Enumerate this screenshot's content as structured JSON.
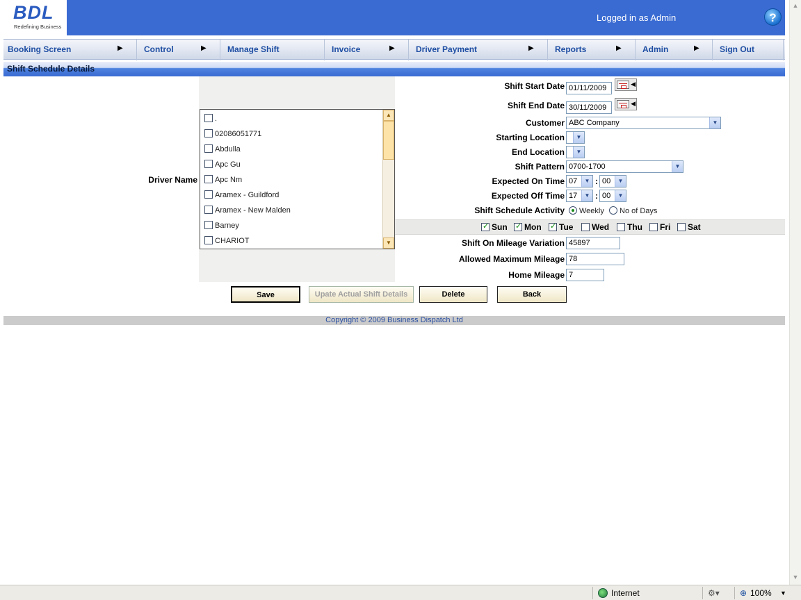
{
  "header": {
    "logo": "BDL",
    "tagline": "Redefining Business",
    "logged_in": "Logged in as Admin",
    "help": "?"
  },
  "menu": [
    {
      "label": "Booking Screen"
    },
    {
      "label": "Control"
    },
    {
      "label": "Manage Shift"
    },
    {
      "label": "Invoice"
    },
    {
      "label": "Driver Payment"
    },
    {
      "label": "Reports"
    },
    {
      "label": "Admin"
    },
    {
      "label": "Sign Out"
    }
  ],
  "page_title": "Shift Schedule Details",
  "driver": {
    "label": "Driver Name",
    "items": [
      ".",
      "02086051771",
      "Abdulla",
      "Apc Gu",
      "Apc Nm",
      "Aramex - Guildford",
      "Aramex - New Malden",
      "Barney",
      "CHARIOT"
    ]
  },
  "form": {
    "start_date_label": "Shift Start Date",
    "start_date": "01/11/2009",
    "end_date_label": "Shift End Date",
    "end_date": "30/11/2009",
    "customer_label": "Customer",
    "customer": "ABC Company",
    "start_location_label": "Starting Location",
    "start_location": "",
    "end_location_label": "End Location",
    "end_location": "",
    "pattern_label": "Shift Pattern",
    "pattern": "0700-1700",
    "on_time_label": "Expected On Time",
    "on_hour": "07",
    "on_min": "00",
    "off_time_label": "Expected Off Time",
    "off_hour": "17",
    "off_min": "00",
    "time_sep": ":",
    "activity_label": "Shift Schedule Activity",
    "activity_options": [
      "Weekly",
      "No of Days"
    ],
    "activity_selected": "Weekly",
    "days": [
      {
        "label": "Sun",
        "checked": true
      },
      {
        "label": "Mon",
        "checked": true
      },
      {
        "label": "Tue",
        "checked": true
      },
      {
        "label": "Wed",
        "checked": false
      },
      {
        "label": "Thu",
        "checked": false
      },
      {
        "label": "Fri",
        "checked": false
      },
      {
        "label": "Sat",
        "checked": false
      }
    ],
    "mileage_var_label": "Shift On Mileage Variation",
    "mileage_var": "45897",
    "max_mileage_label": "Allowed Maximum Mileage",
    "max_mileage": "78",
    "home_mileage_label": "Home Mileage",
    "home_mileage": "7"
  },
  "buttons": {
    "save": "Save",
    "update": "Upate Actual Shift Details",
    "delete": "Delete",
    "back": "Back"
  },
  "footer": "Copyright © 2009 Business Dispatch Ltd",
  "status": {
    "zone": "Internet",
    "zoom": "100%"
  },
  "colors": {
    "header_blue": "#3a6bd2",
    "menu_text": "#1f4ea3"
  }
}
